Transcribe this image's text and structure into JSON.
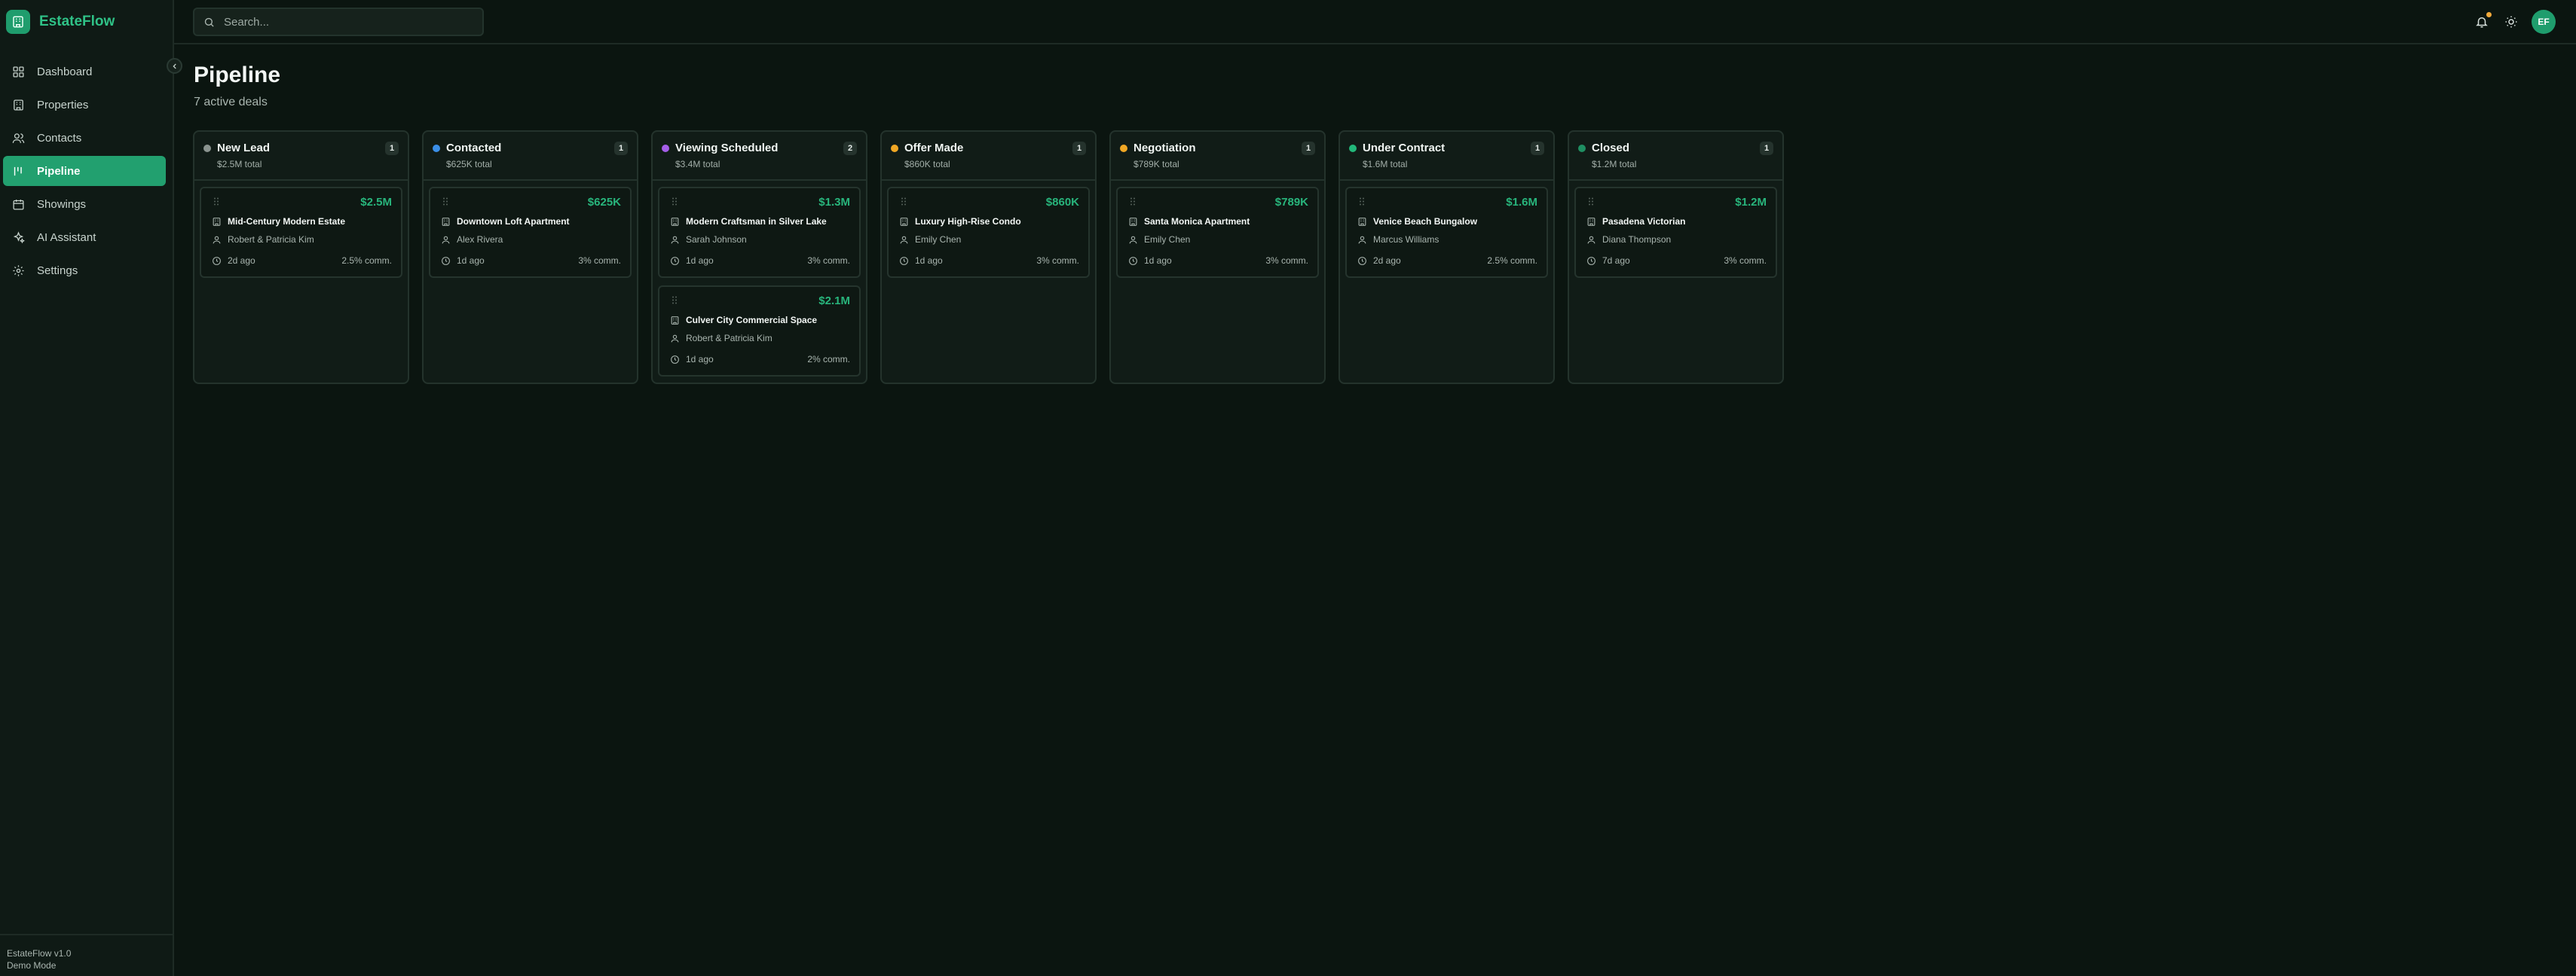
{
  "app": {
    "name": "EstateFlow",
    "version": "EstateFlow v1.0",
    "mode": "Demo Mode"
  },
  "nav": [
    {
      "label": "Dashboard",
      "icon": "dashboard-icon",
      "active": false
    },
    {
      "label": "Properties",
      "icon": "building-icon",
      "active": false
    },
    {
      "label": "Contacts",
      "icon": "users-icon",
      "active": false
    },
    {
      "label": "Pipeline",
      "icon": "pipeline-icon",
      "active": true
    },
    {
      "label": "Showings",
      "icon": "calendar-icon",
      "active": false
    },
    {
      "label": "AI Assistant",
      "icon": "sparkles-icon",
      "active": false
    },
    {
      "label": "Settings",
      "icon": "gear-icon",
      "active": false
    }
  ],
  "search": {
    "placeholder": "Search..."
  },
  "user": {
    "initials": "EF"
  },
  "colors": {
    "accent": "#22a06f",
    "price": "#28b57c",
    "notification": "#f2a93b"
  },
  "page": {
    "title": "Pipeline",
    "subtitle": "7 active deals"
  },
  "columns": [
    {
      "title": "New Lead",
      "total": "$2.5M total",
      "count": "1",
      "color": "#8a938f",
      "cards": [
        {
          "price": "$2.5M",
          "property": "Mid-Century Modern Estate",
          "contact": "Robert & Patricia Kim",
          "age": "2d ago",
          "commission": "2.5% comm."
        }
      ]
    },
    {
      "title": "Contacted",
      "total": "$625K total",
      "count": "1",
      "color": "#3b8fe8",
      "cards": [
        {
          "price": "$625K",
          "property": "Downtown Loft Apartment",
          "contact": "Alex Rivera",
          "age": "1d ago",
          "commission": "3% comm."
        }
      ]
    },
    {
      "title": "Viewing Scheduled",
      "total": "$3.4M total",
      "count": "2",
      "color": "#a45ee8",
      "cards": [
        {
          "price": "$1.3M",
          "property": "Modern Craftsman in Silver Lake",
          "contact": "Sarah Johnson",
          "age": "1d ago",
          "commission": "3% comm."
        },
        {
          "price": "$2.1M",
          "property": "Culver City Commercial Space",
          "contact": "Robert & Patricia Kim",
          "age": "1d ago",
          "commission": "2% comm."
        }
      ]
    },
    {
      "title": "Offer Made",
      "total": "$860K total",
      "count": "1",
      "color": "#f0a724",
      "cards": [
        {
          "price": "$860K",
          "property": "Luxury High-Rise Condo",
          "contact": "Emily Chen",
          "age": "1d ago",
          "commission": "3% comm."
        }
      ]
    },
    {
      "title": "Negotiation",
      "total": "$789K total",
      "count": "1",
      "color": "#f0a724",
      "cards": [
        {
          "price": "$789K",
          "property": "Santa Monica Apartment",
          "contact": "Emily Chen",
          "age": "1d ago",
          "commission": "3% comm."
        }
      ]
    },
    {
      "title": "Under Contract",
      "total": "$1.6M total",
      "count": "1",
      "color": "#22b87a",
      "cards": [
        {
          "price": "$1.6M",
          "property": "Venice Beach Bungalow",
          "contact": "Marcus Williams",
          "age": "2d ago",
          "commission": "2.5% comm."
        }
      ]
    },
    {
      "title": "Closed",
      "total": "$1.2M total",
      "count": "1",
      "color": "#1f8f62",
      "cards": [
        {
          "price": "$1.2M",
          "property": "Pasadena Victorian",
          "contact": "Diana Thompson",
          "age": "7d ago",
          "commission": "3% comm."
        }
      ]
    }
  ]
}
